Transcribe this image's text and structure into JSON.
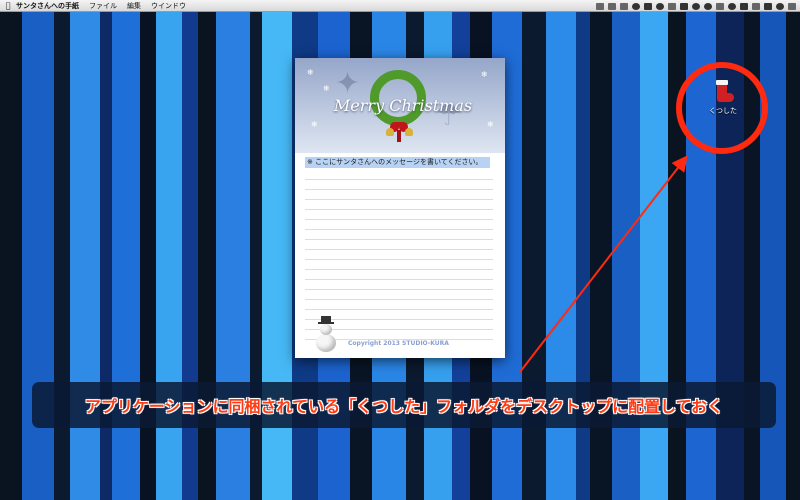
{
  "menubar": {
    "apple_icon": "apple-icon",
    "app_name": "サンタさんへの手紙",
    "menus": [
      "ファイル",
      "編集",
      "ウインドウ"
    ]
  },
  "letter": {
    "greeting": "Merry Christmas",
    "message_placeholder": "※ ここにサンタさんへのメッセージを書いてください。",
    "copyright": "Copyright 2013 STUDIO-KURA"
  },
  "desktop_icon": {
    "label": "くつした",
    "icon": "christmas-stocking-icon"
  },
  "caption": {
    "text": "アプリケーションに同梱されている「くつした」フォルダをデスクトップに配置しておく",
    "color": "#ff3b14"
  },
  "colors": {
    "highlight": "#ff2a10"
  }
}
